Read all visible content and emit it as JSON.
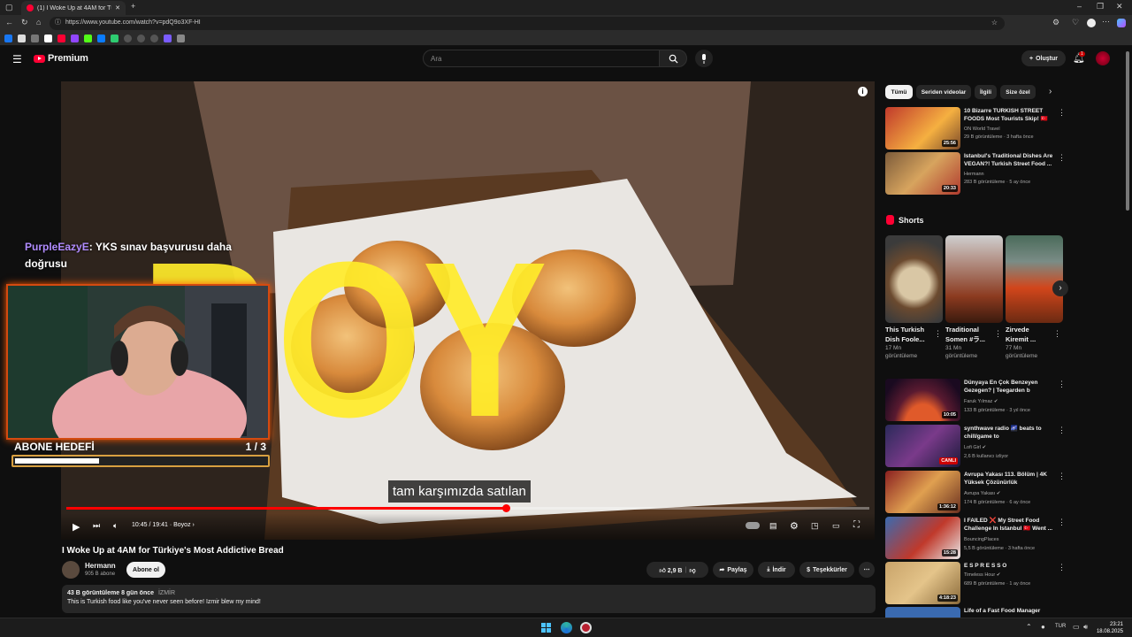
{
  "browser": {
    "tab_title": "(1) I Woke Up at 4AM for Türkiye",
    "url": "https://www.youtube.com/watch?v=pdQ9o3XF-HI"
  },
  "header": {
    "logo_text": "Premium",
    "search_placeholder": "Ara",
    "create_label": "Oluştur",
    "notif_count": "1"
  },
  "player": {
    "time": "10:45 / 19:41",
    "chapter": "Boyoz",
    "progress_fraction": 0.5476,
    "subtitle": "tam karşımızda satılan",
    "overlay_text": "BOY",
    "chat_user": "PurpleEazyE",
    "chat_message": ": YKS sınav başvurusu daha doğrusu",
    "goal_label": "ABONE HEDEFİ",
    "goal_count": "1  / 3",
    "goal_fraction": 0.333
  },
  "video": {
    "title": "I Woke Up at 4AM for Türkiye's Most Addictive Bread",
    "channel": "Hermann",
    "subscribers": "905 B abone",
    "subscribe_label": "Abone ol",
    "likes": "2,9 B",
    "share_label": "Paylaş",
    "download_label": "İndir",
    "thanks_label": "Teşekkürler",
    "views_date": "43 B görüntüleme  8 gün önce",
    "location": "İZMİR",
    "description": "This is Turkish food like you've never seen before! Izmir blew my mind!"
  },
  "sidebar": {
    "chips": [
      "Tümü",
      "Seriden videolar",
      "İlgili",
      "Size özel"
    ],
    "shorts_label": "Shorts",
    "videos_top": [
      {
        "title": "10 Bizarre TURKISH STREET FOODS Most Tourists Skip! 🇹🇷",
        "channel": "ON World Travel",
        "meta": "29 B görüntüleme · 3 hafta önce",
        "duration": "25:56"
      },
      {
        "title": "Istanbul's Traditional Dishes Are VEGAN?! Turkish Street Food ...",
        "channel": "Hermann",
        "meta": "283 B görüntüleme · 5 ay önce",
        "duration": "20:33"
      }
    ],
    "shorts": [
      {
        "title": "This Turkish\nDish Foole...",
        "views": "17 Mn\ngörüntüleme"
      },
      {
        "title": "Traditional\nSomen #ラ...",
        "views": "31 Mn\ngörüntüleme"
      },
      {
        "title": "Zirvede\nKiremit ...",
        "views": "77 Mn\ngörüntüleme"
      }
    ],
    "videos_bottom": [
      {
        "title": "Dünyaya En Çok Benzeyen Gezegen? | Teegarden b",
        "channel": "Faruk Yılmaz ✔",
        "meta": "133 B görüntüleme · 3 yıl önce",
        "duration": "10:05"
      },
      {
        "title": "synthwave radio 🌌 beats to chill/game to",
        "channel": "Lofi Girl ✔",
        "meta": "2,6 B kullanıcı izliyor",
        "duration": "CANLI"
      },
      {
        "title": "Avrupa Yakası 113. Bölüm | 4K Yüksek Çözünürlük",
        "channel": "Avrupa Yakası ✔",
        "meta": "174 B görüntüleme · 6 ay önce",
        "duration": "1:36:12"
      },
      {
        "title": "I FAILED ❌ My Street Food Challenge In Istanbul 🇹🇷 Went ...",
        "channel": "BouncingPlaces",
        "meta": "5,5 B görüntüleme · 3 hafta önce",
        "duration": "15:28"
      },
      {
        "title": "E S P R E S S O",
        "channel": "Timeless Hour ✔",
        "meta": "689 B görüntüleme · 1 ay önce",
        "duration": "4:18:23"
      },
      {
        "title": "Life of a Fast Food Manager",
        "channel": "",
        "meta": "",
        "duration": ""
      }
    ]
  },
  "taskbar": {
    "lang": "TUR",
    "time": "23:21",
    "date": "18.08.2025"
  },
  "colors": {
    "accent": "#ff0033",
    "background": "#0f0f0f"
  }
}
